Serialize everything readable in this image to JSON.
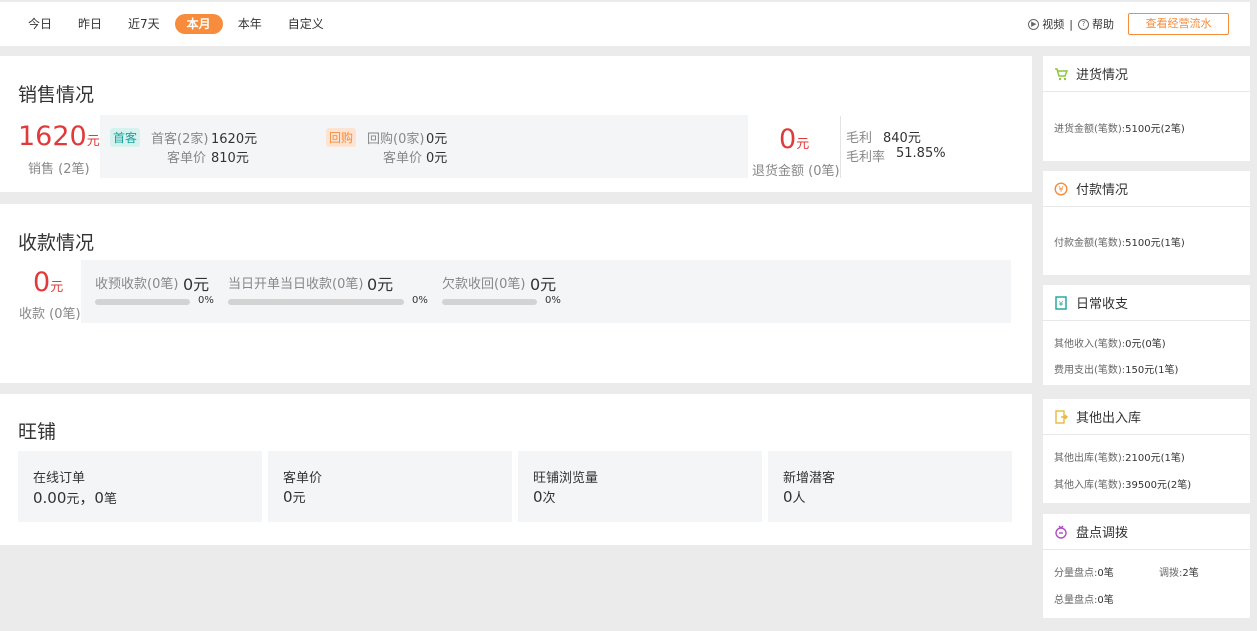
{
  "topbar": {
    "ranges": [
      "今日",
      "昨日",
      "近7天",
      "本月",
      "本年",
      "自定义"
    ],
    "active_range": "本月",
    "video_label": "视频",
    "help_label": "帮助",
    "flow_button": "查看经营流水"
  },
  "sales": {
    "title": "销售情况",
    "amount": "1620",
    "unit": "元",
    "caption": "销售 (2笔)",
    "new_tag": "首客",
    "new_label": "首客(2家)",
    "new_value": "1620元",
    "new_avg_label": "客单价",
    "new_avg_value": "810元",
    "repeat_tag": "回购",
    "repeat_label": "回购(0家)",
    "repeat_value": "0元",
    "repeat_avg_label": "客单价",
    "repeat_avg_value": "0元",
    "refund_amount": "0",
    "refund_unit": "元",
    "refund_caption": "退货金额 (0笔)",
    "profit_label": "毛利",
    "profit_value": "840元",
    "margin_label": "毛利率",
    "margin_value": "51.85%"
  },
  "receipts": {
    "title": "收款情况",
    "amount": "0",
    "unit": "元",
    "caption": "收款 (0笔)",
    "items": [
      {
        "label": "收预收款(0笔)",
        "value": "0元",
        "percent": "0%"
      },
      {
        "label": "当日开单当日收款(0笔)",
        "value": "0元",
        "percent": "0%"
      },
      {
        "label": "欠款收回(0笔)",
        "value": "0元",
        "percent": "0%"
      }
    ]
  },
  "shop": {
    "title": "旺铺",
    "cards": [
      {
        "label": "在线订单",
        "value": "0.00",
        "unit": "元",
        "extra": "，0",
        "extra_unit": "笔"
      },
      {
        "label": "客单价",
        "value": "0",
        "unit": "元"
      },
      {
        "label": "旺铺浏览量",
        "value": "0",
        "unit": "次"
      },
      {
        "label": "新增潜客",
        "value": "0",
        "unit": "人"
      }
    ]
  },
  "right": {
    "purchase": {
      "title": "进货情况",
      "lines": [
        {
          "label": "进货金额(笔数):",
          "value": "5100元(2笔)"
        }
      ]
    },
    "payment": {
      "title": "付款情况",
      "lines": [
        {
          "label": "付款金额(笔数):",
          "value": "5100元(1笔)"
        }
      ]
    },
    "daily": {
      "title": "日常收支",
      "lines": [
        {
          "label": "其他收入(笔数):",
          "value": "0元(0笔)"
        },
        {
          "label": "费用支出(笔数):",
          "value": "150元(1笔)"
        }
      ]
    },
    "stock": {
      "title": "其他出入库",
      "lines": [
        {
          "label": "其他出库(笔数):",
          "value": "2100元(1笔)"
        },
        {
          "label": "其他入库(笔数):",
          "value": "39500元(2笔)"
        }
      ]
    },
    "inventory": {
      "title": "盘点调拨",
      "partial_label": "分量盘点:",
      "partial_value": "0笔",
      "transfer_label": "调拨:",
      "transfer_value": "2笔",
      "total_label": "总量盘点:",
      "total_value": "0笔"
    }
  },
  "colors": {
    "accent": "#f78c3c",
    "red": "#e03a3a",
    "teal": "#1aa39a",
    "gray_block": "#f4f5f7"
  }
}
